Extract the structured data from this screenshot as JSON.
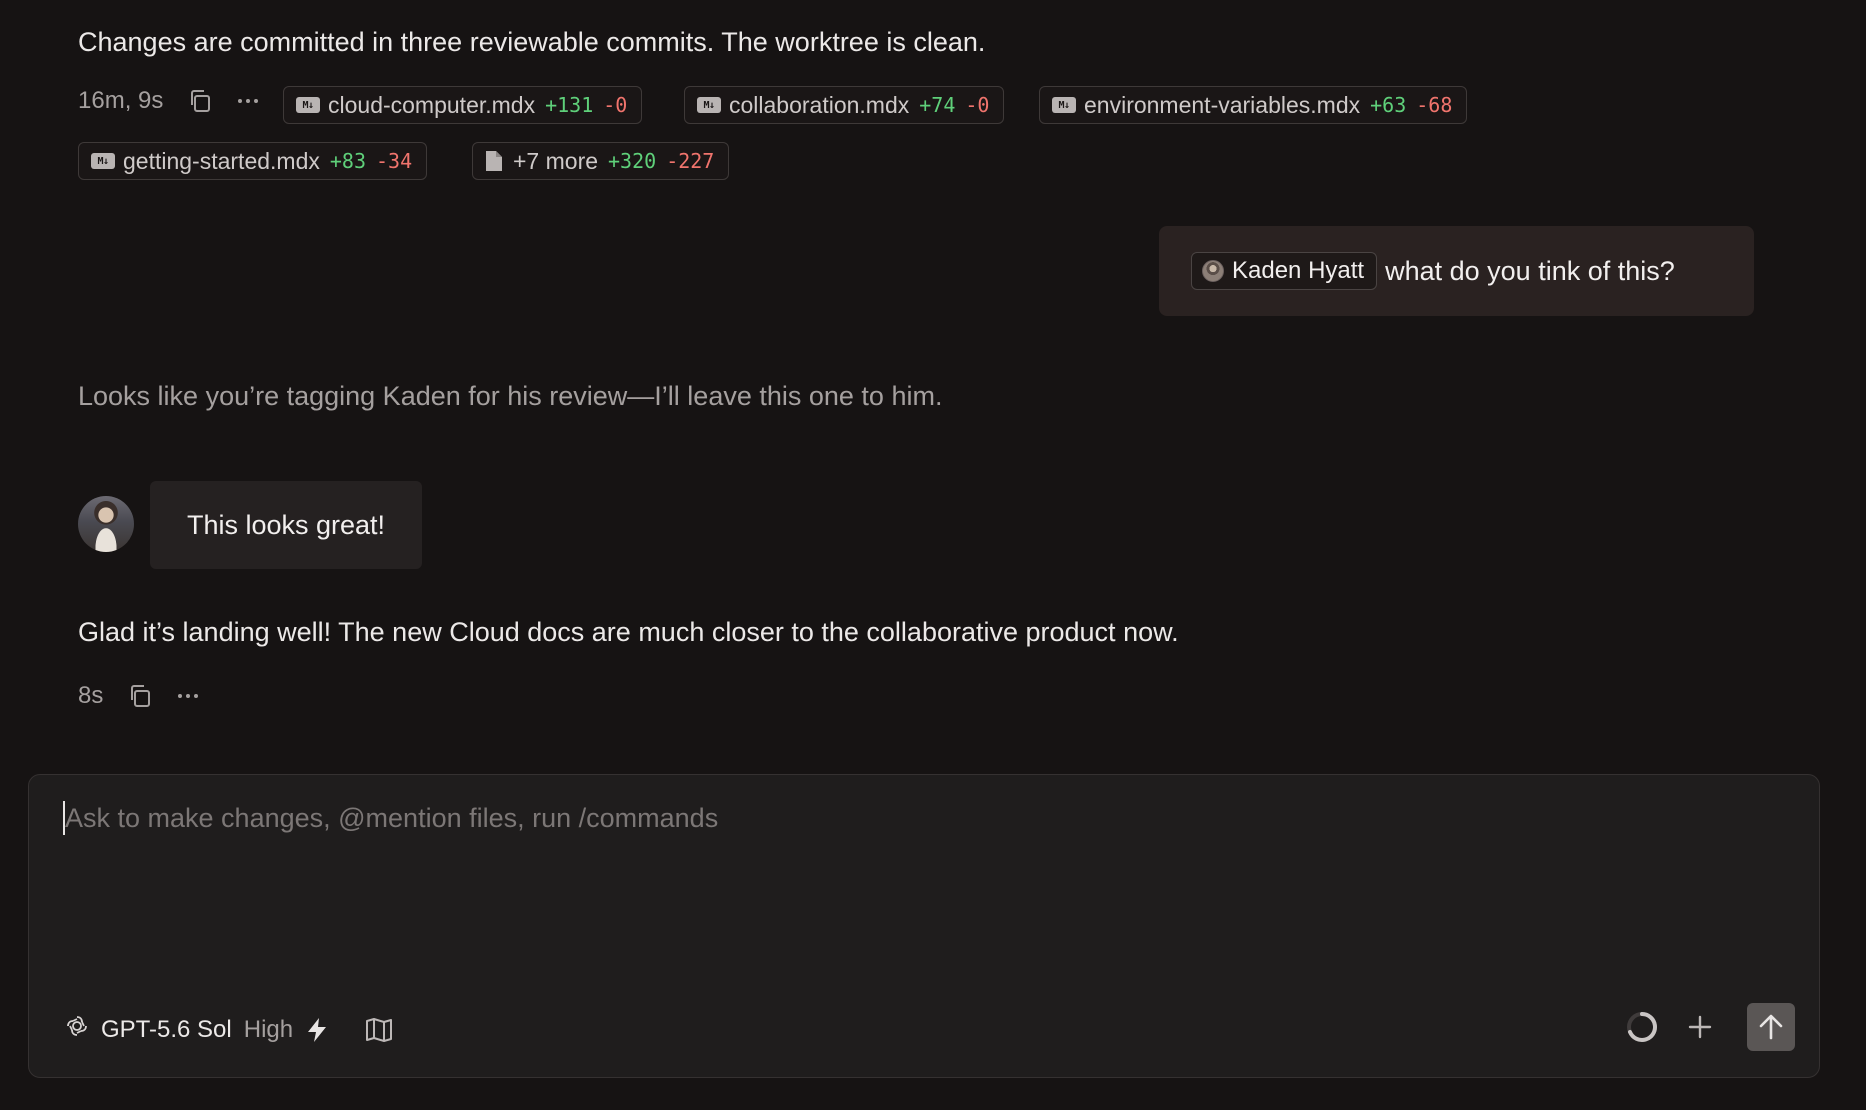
{
  "messages": {
    "assistant_1": {
      "text": "Changes are committed in three reviewable commits. The worktree is clean.",
      "duration": "16m, 9s",
      "files": [
        {
          "name": "cloud-computer.mdx",
          "added": "+131",
          "removed": "-0",
          "icon": "markdown-icon"
        },
        {
          "name": "collaboration.mdx",
          "added": "+74",
          "removed": "-0",
          "icon": "markdown-icon"
        },
        {
          "name": "environment-variables.mdx",
          "added": "+63",
          "removed": "-68",
          "icon": "markdown-icon"
        },
        {
          "name": "getting-started.mdx",
          "added": "+83",
          "removed": "-34",
          "icon": "markdown-icon"
        },
        {
          "name": "+7 more",
          "added": "+320",
          "removed": "-227",
          "icon": "file-icon"
        }
      ]
    },
    "user_1": {
      "mention": "Kaden Hyatt",
      "text": "what do you tink of this?"
    },
    "assistant_2": {
      "text": "Looks like you’re tagging Kaden for his review—I’ll leave this one to him."
    },
    "user_2": {
      "text": "This looks great!"
    },
    "assistant_3": {
      "text": "Glad it’s landing well! The new Cloud docs are much closer to the collaborative product now.",
      "duration": "8s"
    }
  },
  "composer": {
    "placeholder": "Ask to make changes, @mention files, run /commands",
    "model": "GPT-5.6 Sol",
    "effort": "High"
  },
  "colors": {
    "background": "#161313",
    "added": "#5fd07a",
    "removed": "#f0746d",
    "user_bubble": "#2a2221"
  }
}
